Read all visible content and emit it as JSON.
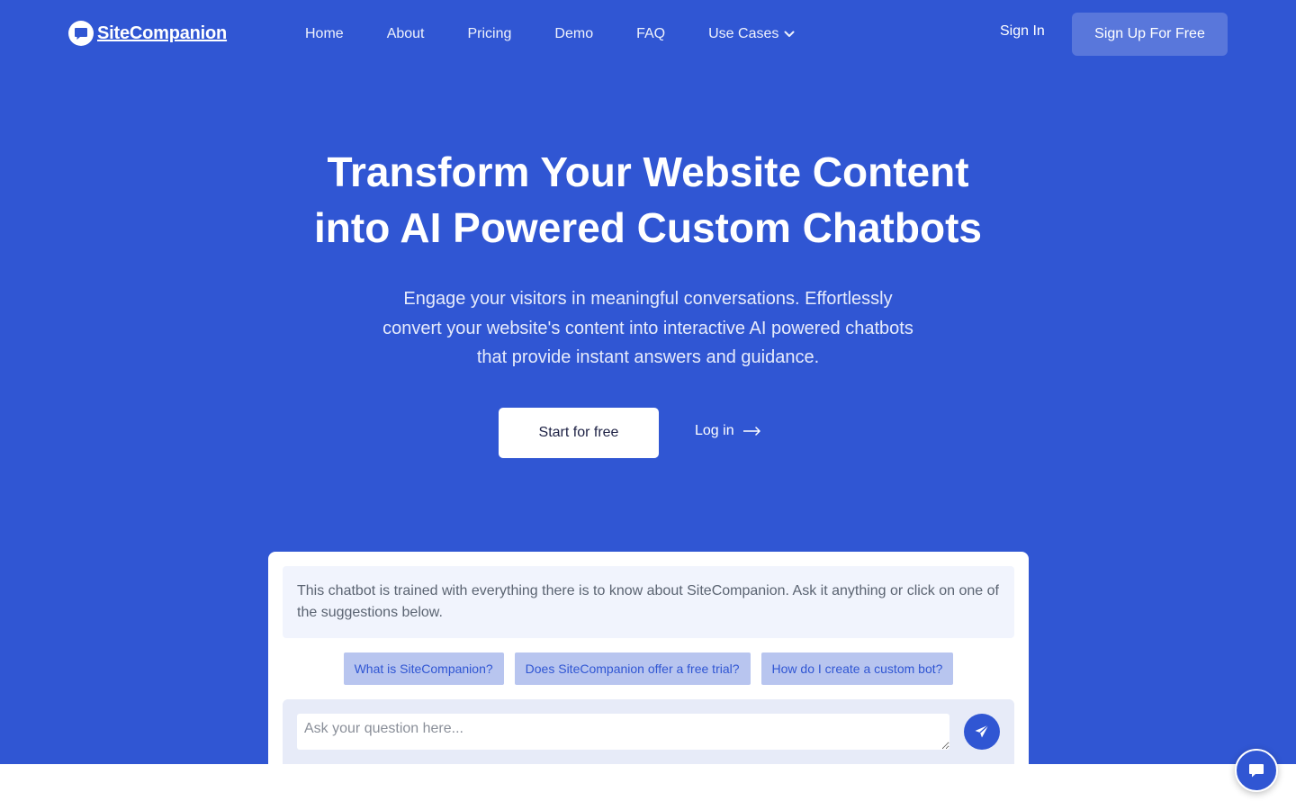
{
  "brand": {
    "name": "SiteCompanion",
    "logo_icon": "chat-bubble-icon"
  },
  "nav": {
    "items": [
      {
        "label": "Home"
      },
      {
        "label": "About"
      },
      {
        "label": "Pricing"
      },
      {
        "label": "Demo"
      },
      {
        "label": "FAQ"
      },
      {
        "label": "Use Cases",
        "icon": "chevron-down-icon"
      }
    ],
    "sign_in": "Sign In",
    "sign_up": "Sign Up For Free"
  },
  "hero": {
    "title_line1": "Transform Your Website Content",
    "title_line2": "into AI Powered Custom Chatbots",
    "subtitle": "Engage your visitors in meaningful conversations. Effortlessly convert your website's content into interactive AI powered chatbots that provide instant answers and guidance.",
    "cta_primary": "Start for free",
    "cta_secondary": "Log in",
    "cta_secondary_icon": "arrow-right-icon"
  },
  "chatbot": {
    "intro": "This chatbot is trained with everything there is to know about SiteCompanion. Ask it anything or click on one of the suggestions below.",
    "suggestions": [
      "What is SiteCompanion?",
      "Does SiteCompanion offer a free trial?",
      "How do I create a custom bot?"
    ],
    "input_placeholder": "Ask your question here...",
    "send_icon": "paper-plane-icon"
  },
  "floating_widget": {
    "icon": "chat-bubble-icon"
  },
  "colors": {
    "primary": "#3056d3",
    "white": "#ffffff",
    "suggestion_bg": "#b8c5ef",
    "intro_bg": "#f1f4fd",
    "input_area_bg": "#e7ebf8"
  }
}
